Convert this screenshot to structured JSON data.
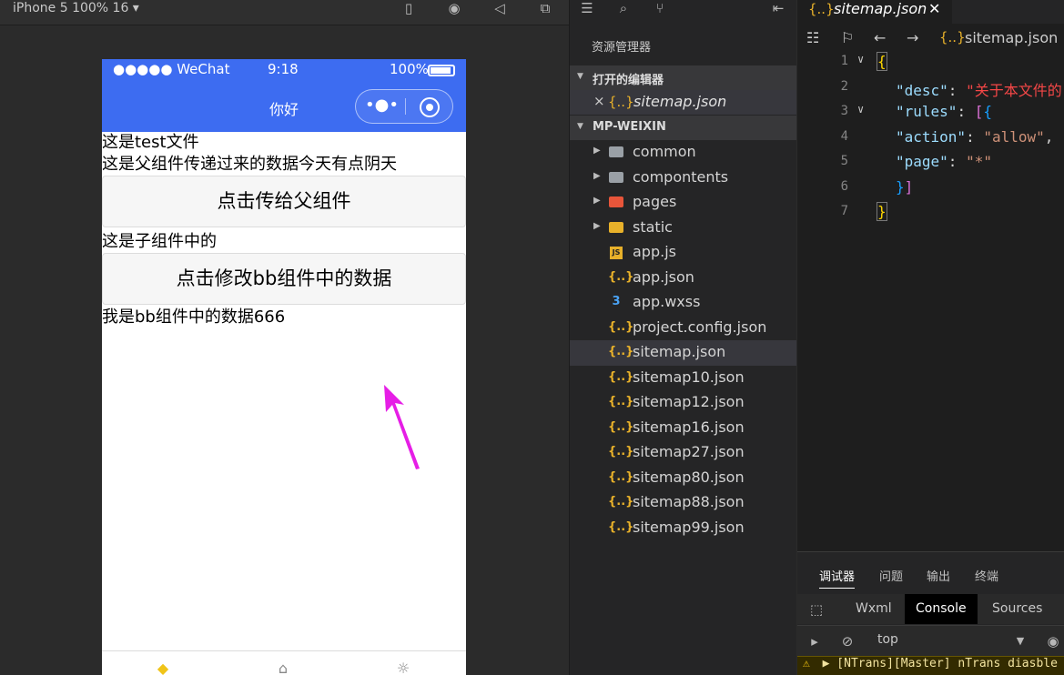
{
  "simulator": {
    "device_label": "iPhone 5 100% 16 ▾",
    "status": {
      "carrier": "●●●●● WeChat",
      "time": "9:18",
      "battery": "100%"
    },
    "nav_title": "你好",
    "content": {
      "line1": "这是test文件",
      "line2": "这是父组件传递过来的数据今天有点阴天",
      "button1": "点击传给父组件",
      "line3": "这是子组件中的",
      "button2": "点击修改bb组件中的数据",
      "line4": "我是bb组件中的数据666"
    },
    "arrow_color": "#e61ee6"
  },
  "explorer": {
    "title": "资源管理器",
    "open_editors_label": "打开的编辑器",
    "open_editor_file": "sitemap.json",
    "project_label": "MP-WEIXIN",
    "files": [
      {
        "name": "common",
        "kind": "folder",
        "color": "#9aa0a6"
      },
      {
        "name": "compontents",
        "kind": "folder",
        "color": "#9aa0a6"
      },
      {
        "name": "pages",
        "kind": "folder",
        "color": "#e8553a"
      },
      {
        "name": "static",
        "kind": "folder",
        "color": "#e8b12a"
      },
      {
        "name": "app.js",
        "kind": "js"
      },
      {
        "name": "app.json",
        "kind": "json"
      },
      {
        "name": "app.wxss",
        "kind": "css"
      },
      {
        "name": "project.config.json",
        "kind": "json"
      },
      {
        "name": "sitemap.json",
        "kind": "json",
        "selected": true
      },
      {
        "name": "sitemap10.json",
        "kind": "json"
      },
      {
        "name": "sitemap12.json",
        "kind": "json"
      },
      {
        "name": "sitemap16.json",
        "kind": "json"
      },
      {
        "name": "sitemap27.json",
        "kind": "json"
      },
      {
        "name": "sitemap80.json",
        "kind": "json"
      },
      {
        "name": "sitemap88.json",
        "kind": "json"
      },
      {
        "name": "sitemap99.json",
        "kind": "json"
      }
    ]
  },
  "editor": {
    "tab_file": "sitemap.json",
    "breadcrumb_file": "sitemap.json >",
    "line_numbers": [
      "1",
      "2",
      "3",
      "4",
      "5",
      "6",
      "7"
    ],
    "code": {
      "l2_key": "\"desc\"",
      "l2_val": "\"关于本文件的",
      "l3_key": "\"rules\"",
      "l4_key": "\"action\"",
      "l4_val": "\"allow\"",
      "l5_key": "\"page\"",
      "l5_val": "\"*\""
    }
  },
  "debug": {
    "tabs": [
      "调试器",
      "问题",
      "输出",
      "终端"
    ],
    "dev_tabs": [
      "Wxml",
      "Console",
      "Sources"
    ],
    "context": "top",
    "warning": "▶ [NTrans][Master] nTrans diasble"
  }
}
